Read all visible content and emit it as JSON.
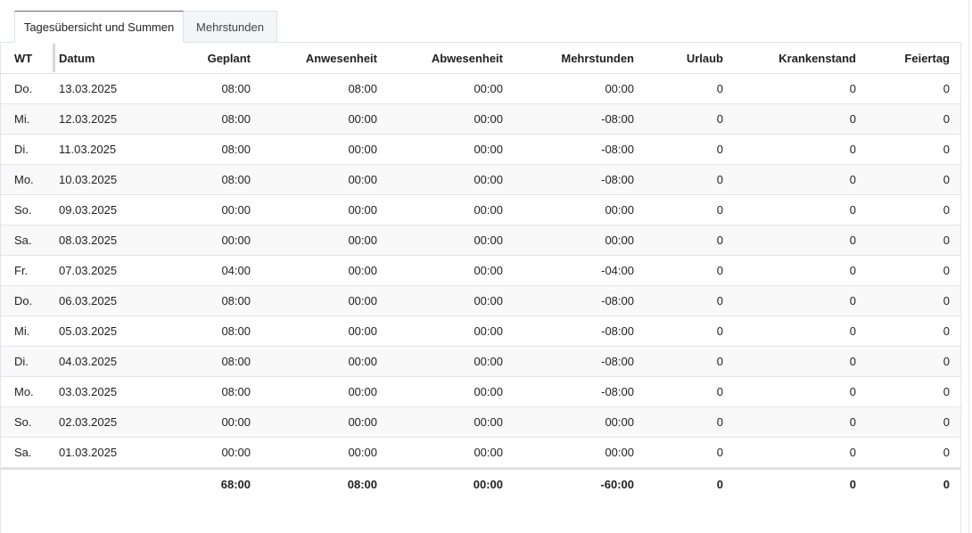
{
  "tabs": [
    {
      "label": "Tagesübersicht und Summen",
      "active": true
    },
    {
      "label": "Mehrstunden",
      "active": false
    }
  ],
  "table": {
    "headers": {
      "wt": "WT",
      "datum": "Datum",
      "geplant": "Geplant",
      "anwesenheit": "Anwesenheit",
      "abwesenheit": "Abwesenheit",
      "mehrstunden": "Mehrstunden",
      "urlaub": "Urlaub",
      "krankenstand": "Krankenstand",
      "feiertag": "Feiertag"
    },
    "rows": [
      {
        "wt": "Do.",
        "datum": "13.03.2025",
        "geplant": "08:00",
        "anwesenheit": "08:00",
        "abwesenheit": "00:00",
        "mehrstunden": "00:00",
        "urlaub": "0",
        "krankenstand": "0",
        "feiertag": "0"
      },
      {
        "wt": "Mi.",
        "datum": "12.03.2025",
        "geplant": "08:00",
        "anwesenheit": "00:00",
        "abwesenheit": "00:00",
        "mehrstunden": "-08:00",
        "urlaub": "0",
        "krankenstand": "0",
        "feiertag": "0"
      },
      {
        "wt": "Di.",
        "datum": "11.03.2025",
        "geplant": "08:00",
        "anwesenheit": "00:00",
        "abwesenheit": "00:00",
        "mehrstunden": "-08:00",
        "urlaub": "0",
        "krankenstand": "0",
        "feiertag": "0"
      },
      {
        "wt": "Mo.",
        "datum": "10.03.2025",
        "geplant": "08:00",
        "anwesenheit": "00:00",
        "abwesenheit": "00:00",
        "mehrstunden": "-08:00",
        "urlaub": "0",
        "krankenstand": "0",
        "feiertag": "0"
      },
      {
        "wt": "So.",
        "datum": "09.03.2025",
        "geplant": "00:00",
        "anwesenheit": "00:00",
        "abwesenheit": "00:00",
        "mehrstunden": "00:00",
        "urlaub": "0",
        "krankenstand": "0",
        "feiertag": "0"
      },
      {
        "wt": "Sa.",
        "datum": "08.03.2025",
        "geplant": "00:00",
        "anwesenheit": "00:00",
        "abwesenheit": "00:00",
        "mehrstunden": "00:00",
        "urlaub": "0",
        "krankenstand": "0",
        "feiertag": "0"
      },
      {
        "wt": "Fr.",
        "datum": "07.03.2025",
        "geplant": "04:00",
        "anwesenheit": "00:00",
        "abwesenheit": "00:00",
        "mehrstunden": "-04:00",
        "urlaub": "0",
        "krankenstand": "0",
        "feiertag": "0"
      },
      {
        "wt": "Do.",
        "datum": "06.03.2025",
        "geplant": "08:00",
        "anwesenheit": "00:00",
        "abwesenheit": "00:00",
        "mehrstunden": "-08:00",
        "urlaub": "0",
        "krankenstand": "0",
        "feiertag": "0"
      },
      {
        "wt": "Mi.",
        "datum": "05.03.2025",
        "geplant": "08:00",
        "anwesenheit": "00:00",
        "abwesenheit": "00:00",
        "mehrstunden": "-08:00",
        "urlaub": "0",
        "krankenstand": "0",
        "feiertag": "0"
      },
      {
        "wt": "Di.",
        "datum": "04.03.2025",
        "geplant": "08:00",
        "anwesenheit": "00:00",
        "abwesenheit": "00:00",
        "mehrstunden": "-08:00",
        "urlaub": "0",
        "krankenstand": "0",
        "feiertag": "0"
      },
      {
        "wt": "Mo.",
        "datum": "03.03.2025",
        "geplant": "08:00",
        "anwesenheit": "00:00",
        "abwesenheit": "00:00",
        "mehrstunden": "-08:00",
        "urlaub": "0",
        "krankenstand": "0",
        "feiertag": "0"
      },
      {
        "wt": "So.",
        "datum": "02.03.2025",
        "geplant": "00:00",
        "anwesenheit": "00:00",
        "abwesenheit": "00:00",
        "mehrstunden": "00:00",
        "urlaub": "0",
        "krankenstand": "0",
        "feiertag": "0"
      },
      {
        "wt": "Sa.",
        "datum": "01.03.2025",
        "geplant": "00:00",
        "anwesenheit": "00:00",
        "abwesenheit": "00:00",
        "mehrstunden": "00:00",
        "urlaub": "0",
        "krankenstand": "0",
        "feiertag": "0"
      }
    ],
    "totals": {
      "geplant": "68:00",
      "anwesenheit": "08:00",
      "abwesenheit": "00:00",
      "mehrstunden": "-60:00",
      "urlaub": "0",
      "krankenstand": "0",
      "feiertag": "0"
    }
  },
  "colors": {
    "active_tab_accent": "#7f5a83",
    "row_stripe": "#f9f9fa",
    "border": "#e3e5e8"
  }
}
